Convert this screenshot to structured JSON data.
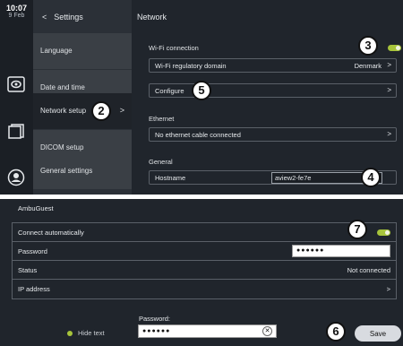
{
  "status": {
    "time": "10:07",
    "date": "9 Feb"
  },
  "settings": {
    "back_label": "Settings",
    "menu": [
      {
        "label": "Language"
      },
      {
        "label": "Date and time"
      },
      {
        "label": "Network setup"
      },
      {
        "label": "DICOM setup"
      },
      {
        "label": "General settings"
      }
    ]
  },
  "network": {
    "title": "Network",
    "wifi_label": "Wi-Fi connection",
    "wifi_enabled": true,
    "regulatory_domain_label": "Wi-Fi regulatory domain",
    "regulatory_domain_value": "Denmark",
    "configure_label": "Configure",
    "ethernet_label": "Ethernet",
    "ethernet_status": "No ethernet cable connected",
    "general_label": "General",
    "hostname_label": "Hostname",
    "hostname_value": "aview2-fe7e"
  },
  "wifi_network": {
    "name": "AmbuGuest",
    "connect_automatically_label": "Connect automatically",
    "connect_automatically": true,
    "password_label": "Password",
    "password_masked": "●●●●●●",
    "status_label": "Status",
    "status_value": "Not connected",
    "ip_address_label": "IP address"
  },
  "password_entry": {
    "hide_text_label": "Hide text",
    "password_label": "Password:",
    "password_masked": "●●●●●●",
    "save_label": "Save"
  },
  "callouts": [
    "2",
    "3",
    "4",
    "5",
    "6",
    "7"
  ],
  "colors": {
    "panel_bg": "#20252c",
    "toggle_on": "#a7c43b"
  }
}
